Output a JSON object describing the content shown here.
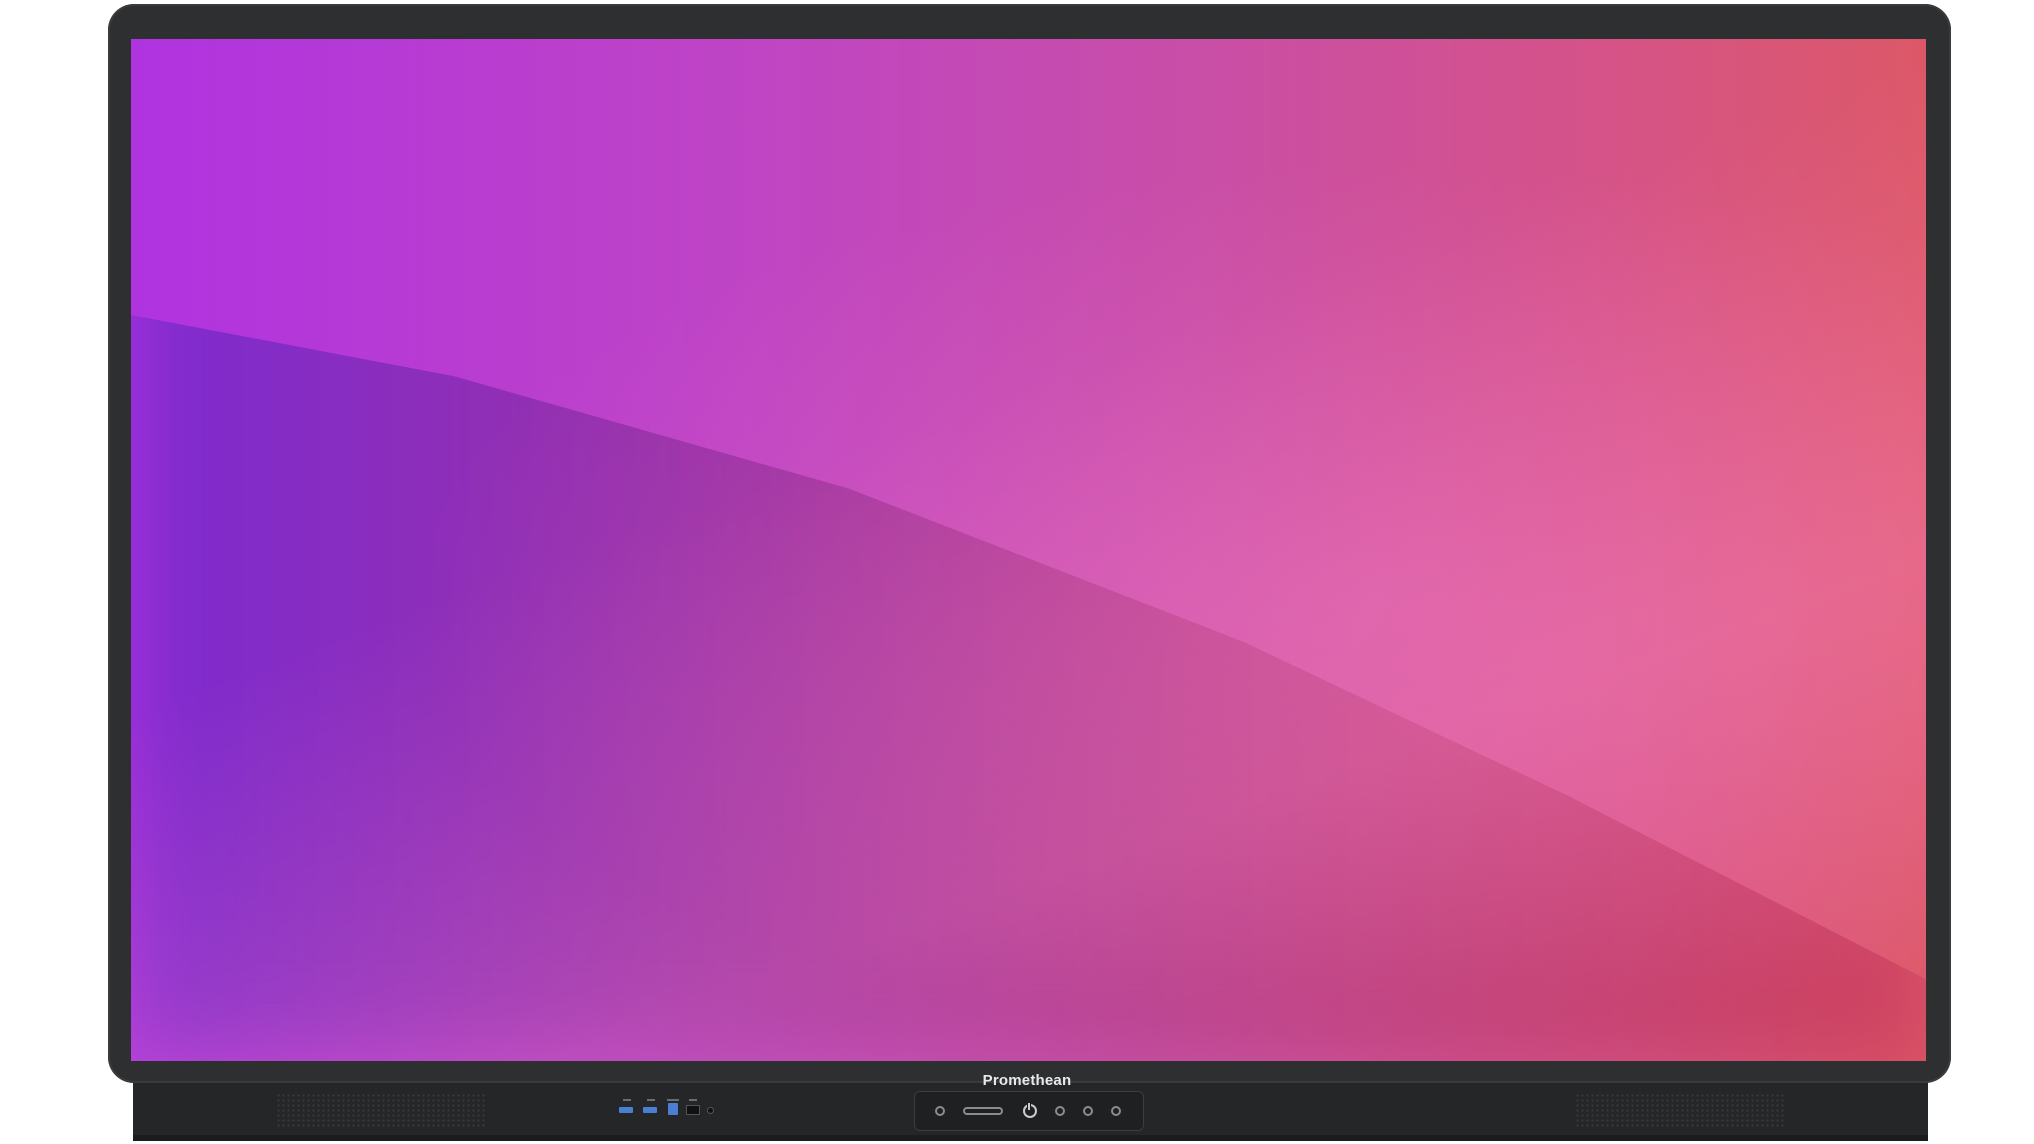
{
  "device": {
    "brand": "Promethean",
    "screen_colors": {
      "top_left": "#b033e0",
      "top_right": "#dc5868",
      "bottom_left": "#7d2ad0",
      "bottom_right": "#e07095"
    },
    "bezel_color": "#2e2f31",
    "port_accent_color": "#4a7fd4"
  },
  "icons": {
    "power": "power-icon",
    "speaker": "speaker-grille"
  }
}
